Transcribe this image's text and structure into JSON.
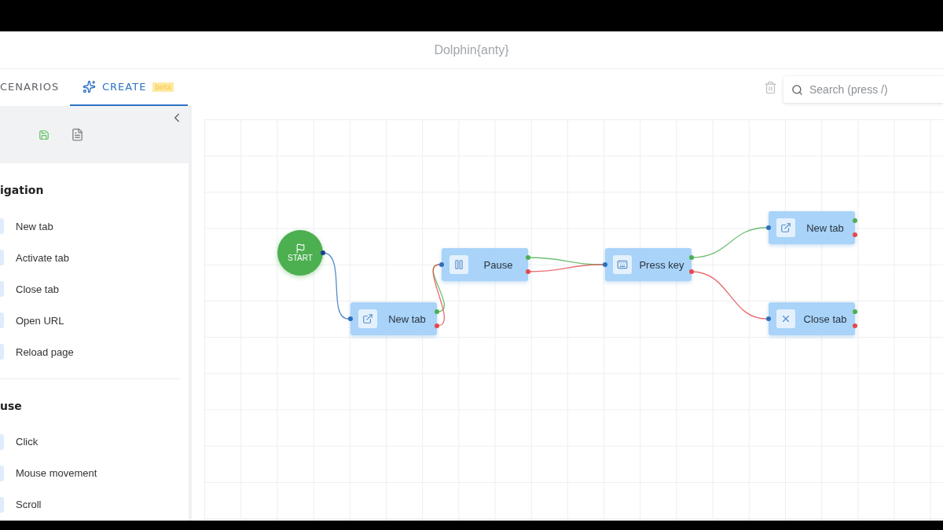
{
  "window": {
    "title": "Dolphin{anty}"
  },
  "tabs": [
    {
      "label": "CENARIOS",
      "selected": false,
      "kind": "plain"
    },
    {
      "label": "CREATE",
      "badge": "beta",
      "selected": true,
      "kind": "create"
    }
  ],
  "search": {
    "placeholder": "Search (press /)"
  },
  "sidebar": {
    "sections": [
      {
        "title": "igation",
        "items": [
          "New tab",
          "Activate tab",
          "Close tab",
          "Open URL",
          "Reload page"
        ]
      },
      {
        "title": "use",
        "items": [
          "Click",
          "Mouse movement",
          "Scroll"
        ]
      }
    ]
  },
  "canvas": {
    "nodes": [
      {
        "kind": "start",
        "label": "START"
      },
      {
        "kind": "new_tab",
        "label": "New tab"
      },
      {
        "kind": "pause",
        "label": "Pause"
      },
      {
        "kind": "press_key",
        "label": "Press key"
      },
      {
        "kind": "new_tab",
        "label": "New tab"
      },
      {
        "kind": "close_tab",
        "label": "Close tab"
      }
    ]
  }
}
